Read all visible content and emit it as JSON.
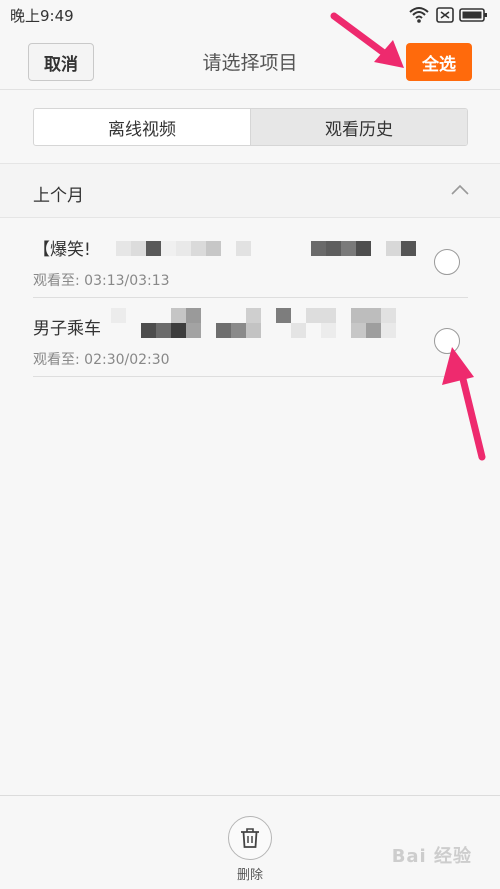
{
  "status": {
    "time": "晚上9:49"
  },
  "header": {
    "cancel_label": "取消",
    "title": "请选择项目",
    "select_all_label": "全选"
  },
  "tabs": [
    {
      "label": "离线视频",
      "active": false
    },
    {
      "label": "观看历史",
      "active": true
    }
  ],
  "section": {
    "label": "上个月"
  },
  "items": [
    {
      "title": "【爆笑!",
      "meta": "观看至: 03:13/03:13",
      "selected": false
    },
    {
      "title": "男子乘车",
      "meta": "观看至: 02:30/02:30",
      "selected": false
    }
  ],
  "bottom": {
    "delete_label": "删除"
  },
  "watermark": "Bai 经验",
  "colors": {
    "accent": "#ff6a0c",
    "annotation_arrow": "#ee2a6e"
  },
  "icons": [
    "wifi-icon",
    "no-sim-icon",
    "battery-icon",
    "chevron-up-icon",
    "trash-icon"
  ]
}
